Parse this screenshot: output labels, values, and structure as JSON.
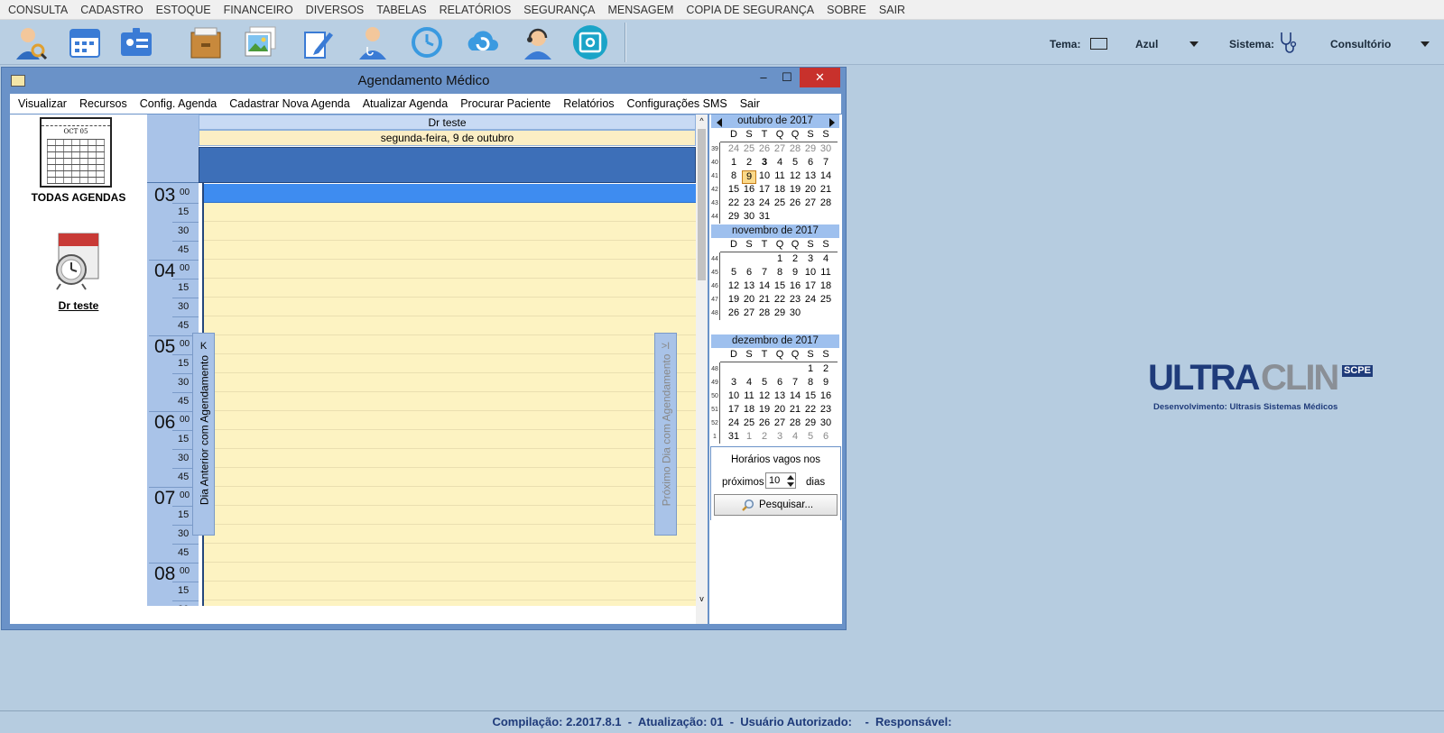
{
  "app_menu": [
    "CONSULTA",
    "CADASTRO",
    "ESTOQUE",
    "FINANCEIRO",
    "DIVERSOS",
    "TABELAS",
    "RELATÓRIOS",
    "SEGURANÇA",
    "MENSAGEM",
    "COPIA DE SEGURANÇA",
    "SOBRE",
    "SAIR"
  ],
  "toolbar": {
    "icons": [
      "patient-search-icon",
      "calendar-icon",
      "contact-card-icon",
      "file-cabinet-icon",
      "gallery-icon",
      "pencil-icon",
      "doctor-icon",
      "history-icon",
      "refresh-cloud-icon",
      "support-headset-icon",
      "safe-icon"
    ],
    "tema_label": "Tema:",
    "tema_value": "Azul",
    "sistema_label": "Sistema:",
    "sistema_value": "Consultório"
  },
  "window": {
    "title": "Agendamento Médico",
    "minimize": "‒",
    "maximize": "☐",
    "close": "✕",
    "menu": [
      "Visualizar",
      "Recursos",
      "Config. Agenda",
      "Cadastrar Nova Agenda",
      "Atualizar Agenda",
      "Procurar Paciente",
      "Relatórios",
      "Configurações SMS",
      "Sair"
    ]
  },
  "left_panel": {
    "calendar_icon_month": "OCT 05",
    "all_agendas_label": "TODAS AGENDAS",
    "doctor_label": "Dr teste"
  },
  "schedule": {
    "resource_name": "Dr teste",
    "date_label": "segunda-feira, 9 de outubro",
    "hours": [
      "03",
      "04",
      "05",
      "06",
      "07",
      "08"
    ],
    "quarter_labels": [
      "00",
      "15",
      "30",
      "45"
    ],
    "prev_tab_arrow": "K",
    "prev_tab_label": "Dia Anterior com Agendamento",
    "next_tab_arrow": ">I",
    "next_tab_label": "Próximo Dia com Agendamento",
    "selected_slot": "03:00"
  },
  "mini_calendar": {
    "weekday_headers": [
      "D",
      "S",
      "T",
      "Q",
      "Q",
      "S",
      "S"
    ],
    "months": [
      {
        "title": "outubro de 2017",
        "weeks": [
          {
            "wk": "39",
            "days": [
              {
                "d": "24",
                "g": true
              },
              {
                "d": "25",
                "g": true
              },
              {
                "d": "26",
                "g": true
              },
              {
                "d": "27",
                "g": true
              },
              {
                "d": "28",
                "g": true
              },
              {
                "d": "29",
                "g": true
              },
              {
                "d": "30",
                "g": true
              }
            ]
          },
          {
            "wk": "40",
            "days": [
              {
                "d": "1"
              },
              {
                "d": "2"
              },
              {
                "d": "3",
                "b": true
              },
              {
                "d": "4"
              },
              {
                "d": "5"
              },
              {
                "d": "6"
              },
              {
                "d": "7"
              }
            ]
          },
          {
            "wk": "41",
            "days": [
              {
                "d": "8"
              },
              {
                "d": "9",
                "sel": true
              },
              {
                "d": "10"
              },
              {
                "d": "11"
              },
              {
                "d": "12"
              },
              {
                "d": "13"
              },
              {
                "d": "14"
              }
            ]
          },
          {
            "wk": "42",
            "days": [
              {
                "d": "15"
              },
              {
                "d": "16"
              },
              {
                "d": "17"
              },
              {
                "d": "18"
              },
              {
                "d": "19"
              },
              {
                "d": "20"
              },
              {
                "d": "21"
              }
            ]
          },
          {
            "wk": "43",
            "days": [
              {
                "d": "22"
              },
              {
                "d": "23"
              },
              {
                "d": "24"
              },
              {
                "d": "25"
              },
              {
                "d": "26"
              },
              {
                "d": "27"
              },
              {
                "d": "28"
              }
            ]
          },
          {
            "wk": "44",
            "days": [
              {
                "d": "29"
              },
              {
                "d": "30"
              },
              {
                "d": "31"
              },
              {
                "d": ""
              },
              {
                "d": ""
              },
              {
                "d": ""
              },
              {
                "d": ""
              }
            ]
          }
        ]
      },
      {
        "title": "novembro de 2017",
        "weeks": [
          {
            "wk": "44",
            "days": [
              {
                "d": ""
              },
              {
                "d": ""
              },
              {
                "d": ""
              },
              {
                "d": "1"
              },
              {
                "d": "2"
              },
              {
                "d": "3"
              },
              {
                "d": "4"
              }
            ]
          },
          {
            "wk": "45",
            "days": [
              {
                "d": "5"
              },
              {
                "d": "6"
              },
              {
                "d": "7"
              },
              {
                "d": "8"
              },
              {
                "d": "9"
              },
              {
                "d": "10"
              },
              {
                "d": "11"
              }
            ]
          },
          {
            "wk": "46",
            "days": [
              {
                "d": "12"
              },
              {
                "d": "13"
              },
              {
                "d": "14"
              },
              {
                "d": "15"
              },
              {
                "d": "16"
              },
              {
                "d": "17"
              },
              {
                "d": "18"
              }
            ]
          },
          {
            "wk": "47",
            "days": [
              {
                "d": "19"
              },
              {
                "d": "20"
              },
              {
                "d": "21"
              },
              {
                "d": "22"
              },
              {
                "d": "23"
              },
              {
                "d": "24"
              },
              {
                "d": "25"
              }
            ]
          },
          {
            "wk": "48",
            "days": [
              {
                "d": "26"
              },
              {
                "d": "27"
              },
              {
                "d": "28"
              },
              {
                "d": "29"
              },
              {
                "d": "30"
              },
              {
                "d": ""
              },
              {
                "d": ""
              }
            ]
          }
        ]
      },
      {
        "title": "dezembro de 2017",
        "weeks": [
          {
            "wk": "48",
            "days": [
              {
                "d": ""
              },
              {
                "d": ""
              },
              {
                "d": ""
              },
              {
                "d": ""
              },
              {
                "d": ""
              },
              {
                "d": "1"
              },
              {
                "d": "2"
              }
            ]
          },
          {
            "wk": "49",
            "days": [
              {
                "d": "3"
              },
              {
                "d": "4"
              },
              {
                "d": "5"
              },
              {
                "d": "6"
              },
              {
                "d": "7"
              },
              {
                "d": "8"
              },
              {
                "d": "9"
              }
            ]
          },
          {
            "wk": "50",
            "days": [
              {
                "d": "10"
              },
              {
                "d": "11"
              },
              {
                "d": "12"
              },
              {
                "d": "13"
              },
              {
                "d": "14"
              },
              {
                "d": "15"
              },
              {
                "d": "16"
              }
            ]
          },
          {
            "wk": "51",
            "days": [
              {
                "d": "17"
              },
              {
                "d": "18"
              },
              {
                "d": "19"
              },
              {
                "d": "20"
              },
              {
                "d": "21"
              },
              {
                "d": "22"
              },
              {
                "d": "23"
              }
            ]
          },
          {
            "wk": "52",
            "days": [
              {
                "d": "24"
              },
              {
                "d": "25"
              },
              {
                "d": "26"
              },
              {
                "d": "27"
              },
              {
                "d": "28"
              },
              {
                "d": "29"
              },
              {
                "d": "30"
              }
            ]
          },
          {
            "wk": "1",
            "days": [
              {
                "d": "31"
              },
              {
                "d": "1",
                "g": true
              },
              {
                "d": "2",
                "g": true
              },
              {
                "d": "3",
                "g": true
              },
              {
                "d": "4",
                "g": true
              },
              {
                "d": "5",
                "g": true
              },
              {
                "d": "6",
                "g": true
              }
            ]
          }
        ]
      }
    ]
  },
  "free_slots": {
    "title": "Horários vagos nos",
    "prefix": "próximos",
    "days_value": "10",
    "suffix": "dias",
    "search_label": "Pesquisar..."
  },
  "logo": {
    "brand_part1": "ULTRA",
    "brand_part2": "CLIN",
    "badge": "SCPE",
    "tagline": "Desenvolvimento: Ultrasis Sistemas Médicos"
  },
  "status_bar": "Compilação: 2.2017.8.1  -  Atualização: 01  -  Usuário Autorizado:    -  Responsável:",
  "colors": {
    "desktop": "#b6cce0",
    "window_frame": "#6a92c8",
    "slot": "#fdf3c2",
    "slot_selected": "#3e8cf0",
    "close_button": "#c8312c",
    "logo_blue": "#1f3b7a",
    "logo_gray": "#8a8f96"
  }
}
